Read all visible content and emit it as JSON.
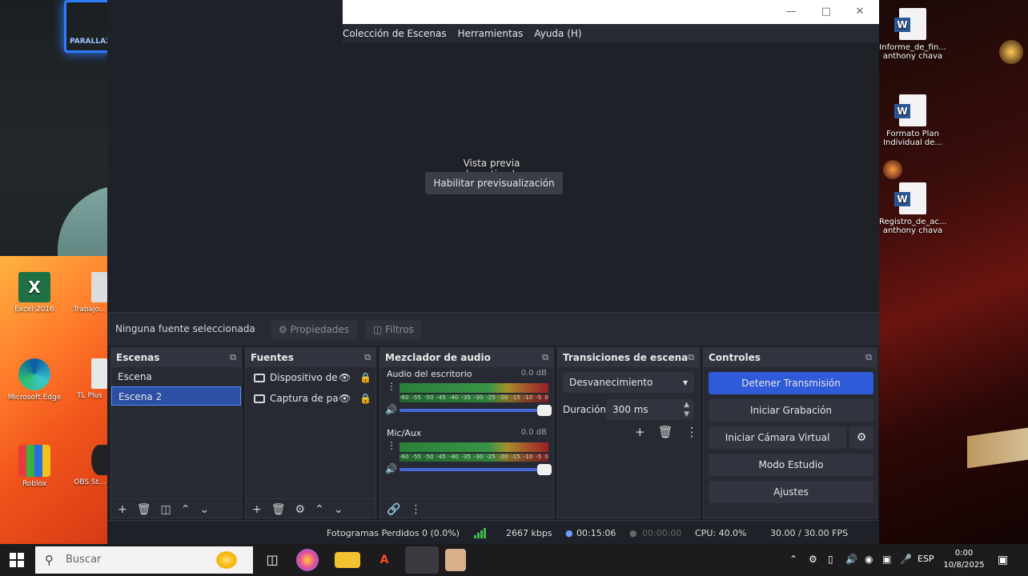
{
  "desktop": {
    "right_icons": [
      {
        "label": "Informe_de_fin... anthony chava"
      },
      {
        "label": "Formato Plan Individual de..."
      },
      {
        "label": "Registro_de_ac... anthony chava"
      }
    ],
    "left_icons": [
      {
        "label": "Excel 2016"
      },
      {
        "label": "Microsoft Edge"
      },
      {
        "label": "Roblox"
      }
    ],
    "left_partial_icons": [
      {
        "label": "Trabajo..."
      },
      {
        "label": "TL Plus"
      },
      {
        "label": "OBS St..."
      }
    ]
  },
  "webcam": {
    "sign_text": "PARALLAX"
  },
  "obs": {
    "menu": [
      "Colección de Escenas",
      "Herramientas",
      "Ayuda (H)"
    ],
    "preview": {
      "disabled_text": "Vista previa desactivada",
      "enable_button": "Habilitar previsualización"
    },
    "source_bar": {
      "no_selection": "Ninguna fuente seleccionada",
      "properties": "Propiedades",
      "filters": "Filtros"
    },
    "scenes": {
      "title": "Escenas",
      "items": [
        "Escena",
        "Escena 2"
      ],
      "selected_index": 1
    },
    "sources": {
      "title": "Fuentes",
      "items": [
        "Dispositivo de",
        "Captura de pa"
      ]
    },
    "mixer": {
      "title": "Mezclador de audio",
      "channels": [
        {
          "name": "Audio del escritorio",
          "db": "0.0 dB"
        },
        {
          "name": "Mic/Aux",
          "db": "0.0 dB"
        }
      ],
      "ticks": [
        "-60",
        "-55",
        "-50",
        "-45",
        "-40",
        "-35",
        "-30",
        "-25",
        "-20",
        "-15",
        "-10",
        "-5",
        "0"
      ]
    },
    "transitions": {
      "title": "Transiciones de escena",
      "selected": "Desvanecimiento",
      "duration_label": "Duración",
      "duration_value": "300 ms"
    },
    "controls": {
      "title": "Controles",
      "stop_stream": "Detener Transmisión",
      "start_recording": "Iniciar Grabación",
      "start_virtual_cam": "Iniciar Cámara Virtual",
      "studio_mode": "Modo Estudio",
      "settings": "Ajustes"
    },
    "status": {
      "dropped_frames": "Fotogramas Perdidos 0 (0.0%)",
      "bitrate": "2667 kbps",
      "stream_time": "00:15:06",
      "rec_time": "00:00:00",
      "cpu": "CPU: 40.0%",
      "fps": "30.00 / 30.00 FPS"
    }
  },
  "taskbar": {
    "search_placeholder": "Buscar",
    "language": "ESP",
    "time": "0:00",
    "date": "10/8/2025"
  },
  "colors": {
    "accent": "#2f5bd8",
    "panel": "#272a33",
    "bg": "#1f2128"
  }
}
